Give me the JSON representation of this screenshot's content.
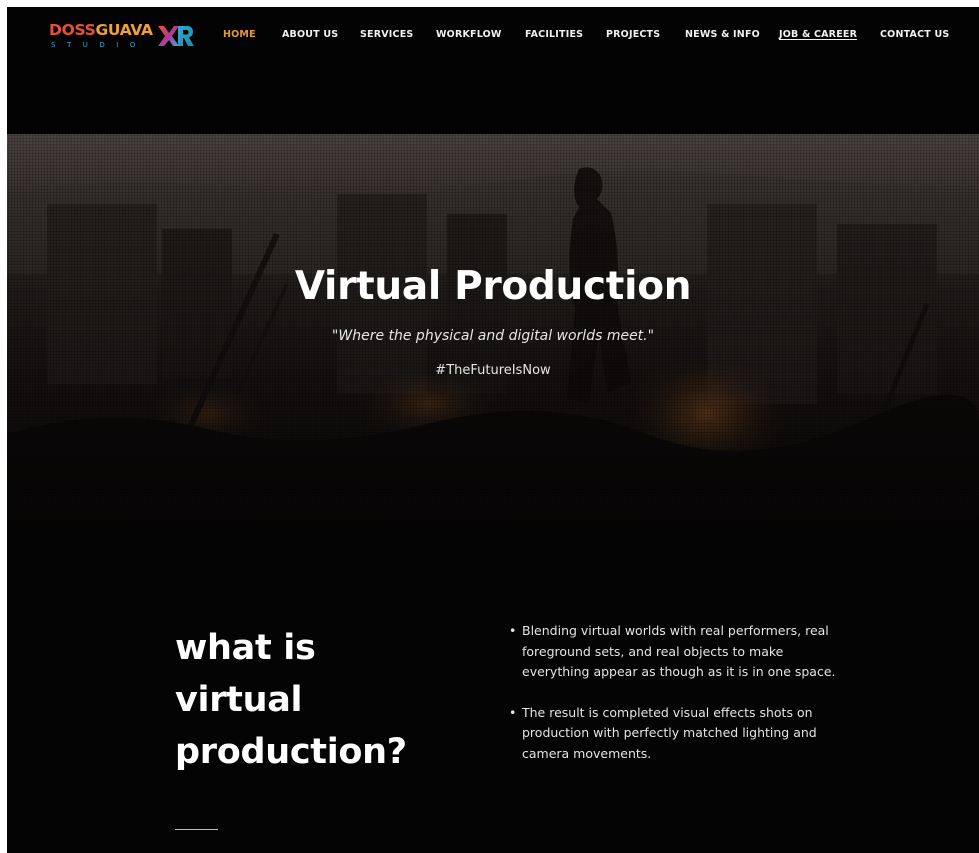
{
  "brand": {
    "name_part1": "DOSS",
    "name_part2": "GUAVA",
    "mark": "XR",
    "subtitle": "STUDIO"
  },
  "nav": {
    "items": [
      {
        "label": "HOME",
        "state": "active"
      },
      {
        "label": "ABOUT US"
      },
      {
        "label": "SERVICES"
      },
      {
        "label": "WORKFLOW"
      },
      {
        "label": "FACILITIES"
      },
      {
        "label": "PROJECTS"
      },
      {
        "label": "NEWS & INFO"
      },
      {
        "label": "JOB & CAREER",
        "state": "underlined"
      },
      {
        "label": "CONTACT US"
      }
    ]
  },
  "hero": {
    "title": "Virtual Production",
    "quote": "\"Where the physical and digital worlds meet.\"",
    "hashtag": "#TheFutureIsNow"
  },
  "section": {
    "heading_lines": [
      "what is",
      "virtual",
      "production?"
    ],
    "bullets": [
      "Blending virtual worlds with real performers, real foreground sets, and real objects to make everything appear as though as it is in one space.",
      "The result is completed visual effects shots on production with perfectly matched lighting and camera movements."
    ],
    "bullet_symbol": "•"
  },
  "colors": {
    "background": "#040404",
    "nav_active": "#e99a2f",
    "logo_red": "#e8523b",
    "logo_orange": "#f0a03a",
    "logo_blue": "#3aa7d6",
    "text": "#ffffff"
  }
}
